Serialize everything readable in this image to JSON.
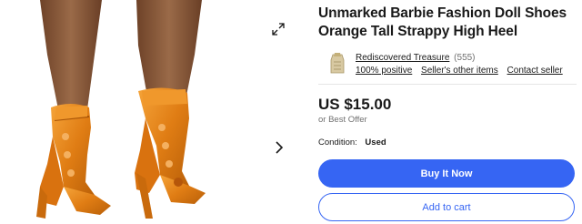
{
  "listing": {
    "title": "Unmarked Barbie Fashion Doll Shoes Orange Tall Strappy High Heel"
  },
  "gallery": {
    "expand_icon": "expand-arrows-icon",
    "next_icon": "chevron-right-icon"
  },
  "seller": {
    "name": "Rediscovered Treasure",
    "feedback_count": "(555)",
    "positive": "100% positive",
    "other_items": "Seller's other items",
    "contact": "Contact seller"
  },
  "pricing": {
    "price": "US $15.00",
    "best_offer": "or Best Offer"
  },
  "condition": {
    "label": "Condition:",
    "value": "Used"
  },
  "actions": {
    "buy_now": "Buy It Now",
    "add_to_cart": "Add to cart"
  },
  "colors": {
    "accent": "#3665f3",
    "shoe_orange": "#e8891c",
    "skin": "#8a5a3c"
  }
}
